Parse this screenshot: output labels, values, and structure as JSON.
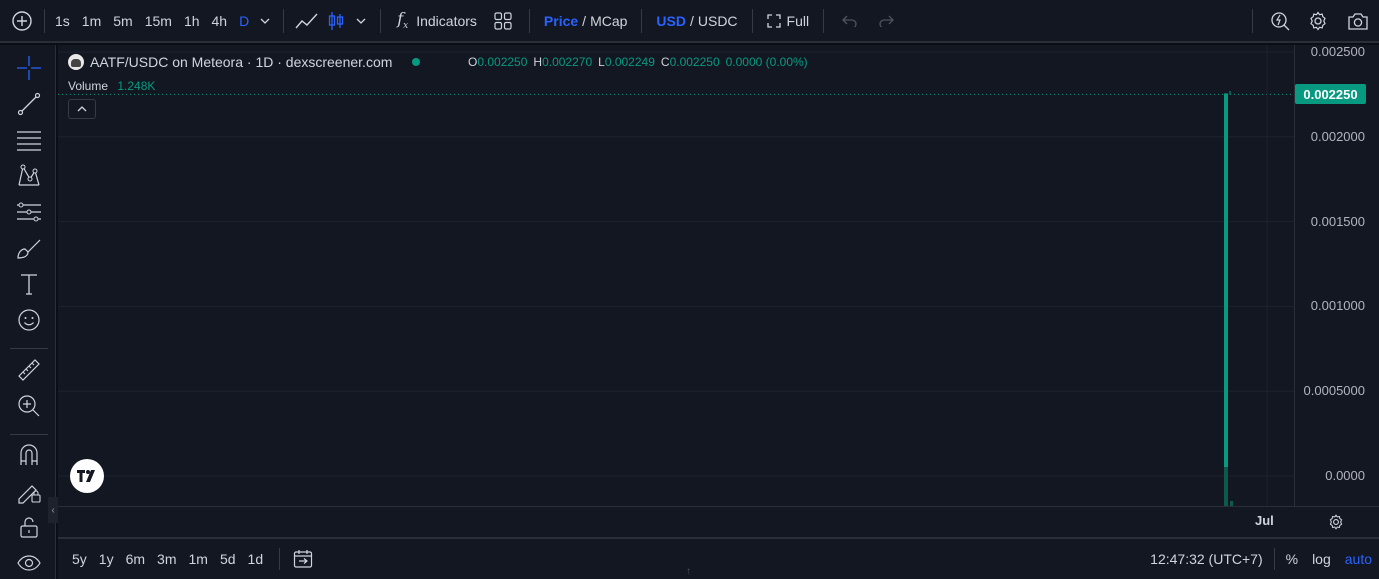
{
  "toolbar": {
    "intervals": [
      {
        "label": "1s",
        "active": false
      },
      {
        "label": "1m",
        "active": false
      },
      {
        "label": "5m",
        "active": false
      },
      {
        "label": "15m",
        "active": false
      },
      {
        "label": "1h",
        "active": false
      },
      {
        "label": "4h",
        "active": false
      },
      {
        "label": "D",
        "active": true
      }
    ],
    "indicators_label": "Indicators",
    "price_label": "Price",
    "mcap_label": "MCap",
    "usd_label": "USD",
    "usdc_label": "USDC",
    "slash": "/",
    "full_label": "Full",
    "accent_color": "#2962ff"
  },
  "legend": {
    "title": "AATF/USDC on Meteora · 1D · dexscreener.com",
    "ohlc": {
      "o_key": "O",
      "o": "0.002250",
      "h_key": "H",
      "h": "0.002270",
      "l_key": "L",
      "l": "0.002249",
      "c_key": "C",
      "c": "0.002250",
      "change": "0.0000 (0.00%)"
    },
    "volume_label": "Volume",
    "volume_value": "1.248K",
    "up_color": "#089981"
  },
  "price_scale": {
    "ticks": [
      "0.002500",
      "0.002000",
      "0.001500",
      "0.001000",
      "0.0005000",
      "0.0000"
    ],
    "last_price": "0.002250"
  },
  "time_scale": {
    "labels": [
      "Jul"
    ]
  },
  "bottom": {
    "ranges": [
      "5y",
      "1y",
      "6m",
      "3m",
      "1m",
      "5d",
      "1d"
    ],
    "clock": "12:47:32 (UTC+7)",
    "percent_label": "%",
    "log_label": "log",
    "auto_label": "auto"
  },
  "chart_data": {
    "type": "bar",
    "description_series": "candlestick",
    "categories": [
      "Jul"
    ],
    "series": [
      {
        "open": 0.00225,
        "high": 0.00227,
        "low": 0.002249,
        "close": 0.00225
      }
    ],
    "ylim": [
      0,
      0.0025
    ],
    "volume": 1248
  }
}
